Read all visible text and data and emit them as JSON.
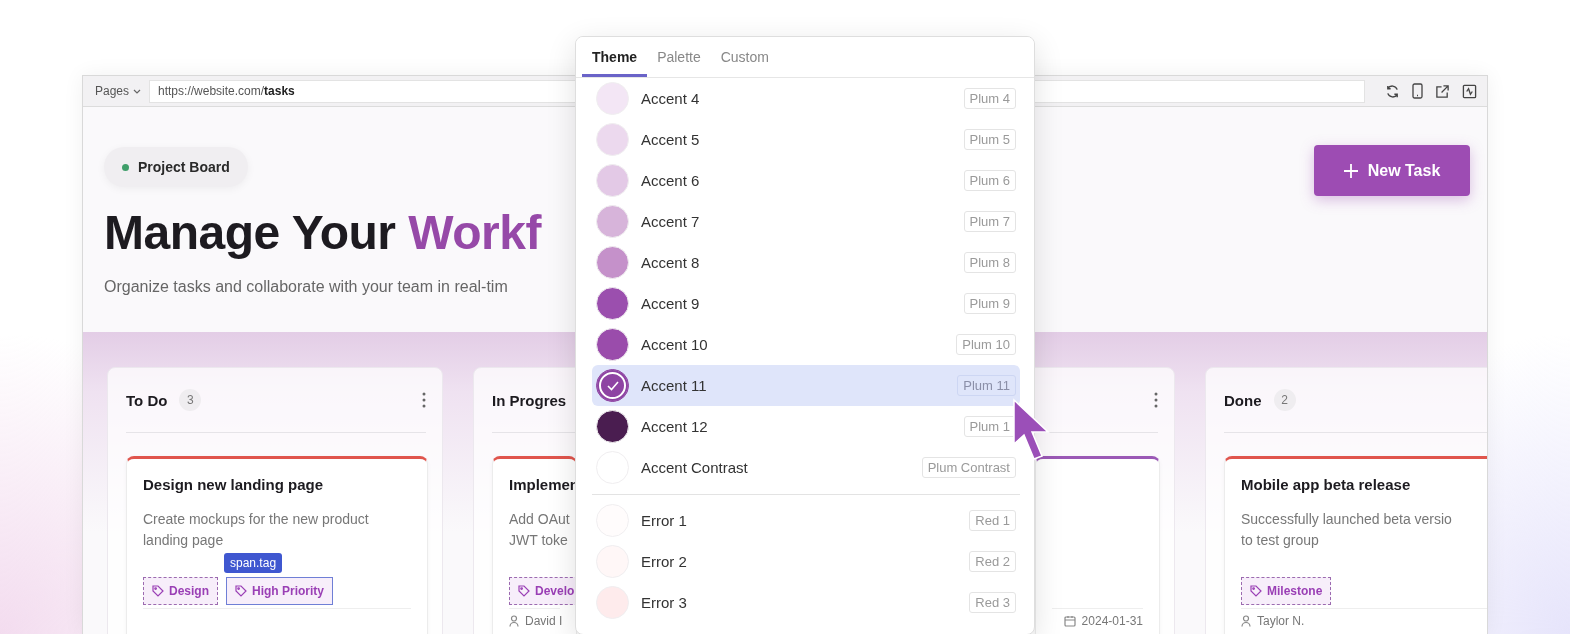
{
  "browser": {
    "pages_label": "Pages",
    "url": "https://website.com/**tasks**"
  },
  "header": {
    "badge": "Project Board",
    "title": "Manage Your",
    "title_accent": "Workf",
    "subtitle": "Organize tasks and collaborate with your team in real-tim",
    "new_task_button": "New Task"
  },
  "columns": [
    {
      "title": "To Do",
      "count": "3",
      "cards": [
        {
          "color": "#e0554d",
          "title": "Design new landing page",
          "description": [
            "Create mockups for the new product",
            "landing page"
          ],
          "tags": [
            {
              "label": "Design",
              "highlighted": false
            },
            {
              "label": "High Priority",
              "highlighted": true
            }
          ]
        }
      ]
    },
    {
      "title": "In Progres",
      "cards": [
        {
          "color": "#e0554d",
          "title": "Implemen",
          "description": [
            "Add OAut",
            "JWT toke"
          ],
          "tags": [
            {
              "label": "Develo",
              "highlighted": false
            }
          ],
          "assignee": "David I"
        }
      ]
    },
    {
      "cards": [
        {
          "color": "#9b59b6",
          "due_date": "2024-01-31"
        }
      ]
    },
    {
      "title": "Done",
      "count": "2",
      "cards": [
        {
          "color": "#e0554d",
          "title": "Mobile app beta release",
          "description": [
            "Successfully launched beta versio",
            "to test group"
          ],
          "tags": [
            {
              "label": "Milestone",
              "highlighted": false
            }
          ],
          "assignee": "Taylor N."
        }
      ]
    }
  ],
  "inspector": {
    "label": "span.tag"
  },
  "theme_picker": {
    "tabs": [
      {
        "label": "Theme",
        "selected": true
      },
      {
        "label": "Palette",
        "selected": false
      },
      {
        "label": "Custom",
        "selected": false
      }
    ],
    "groups": [
      {
        "items": [
          {
            "label": "Accent 4",
            "token": "Plum 4",
            "color": "#f3e6f5",
            "selected": false
          },
          {
            "label": "Accent 5",
            "token": "Plum 5",
            "color": "#ecd9ee",
            "selected": false
          },
          {
            "label": "Accent 6",
            "token": "Plum 6",
            "color": "#e3c9e6",
            "selected": false
          },
          {
            "label": "Accent 7",
            "token": "Plum 7",
            "color": "#d7b4da",
            "selected": false
          },
          {
            "label": "Accent 8",
            "token": "Plum 8",
            "color": "#c591ca",
            "selected": false
          },
          {
            "label": "Accent 9",
            "token": "Plum 9",
            "color": "#9b4fae",
            "selected": false
          },
          {
            "label": "Accent 10",
            "token": "Plum 10",
            "color": "#9a4cab",
            "selected": false
          },
          {
            "label": "Accent 11",
            "token": "Plum 11",
            "color": "#8e44a3",
            "selected": true
          },
          {
            "label": "Accent 12",
            "token": "Plum 1",
            "color": "#4a1d50",
            "selected": false
          },
          {
            "label": "Accent Contrast",
            "token": "Plum Contrast",
            "color": "#ffffff",
            "selected": false
          }
        ]
      },
      {
        "items": [
          {
            "label": "Error 1",
            "token": "Red 1",
            "color": "#fffcfc",
            "selected": false
          },
          {
            "label": "Error 2",
            "token": "Red 2",
            "color": "#fff7f7",
            "selected": false
          },
          {
            "label": "Error 3",
            "token": "Red 3",
            "color": "#feebec",
            "selected": false
          }
        ]
      }
    ]
  }
}
